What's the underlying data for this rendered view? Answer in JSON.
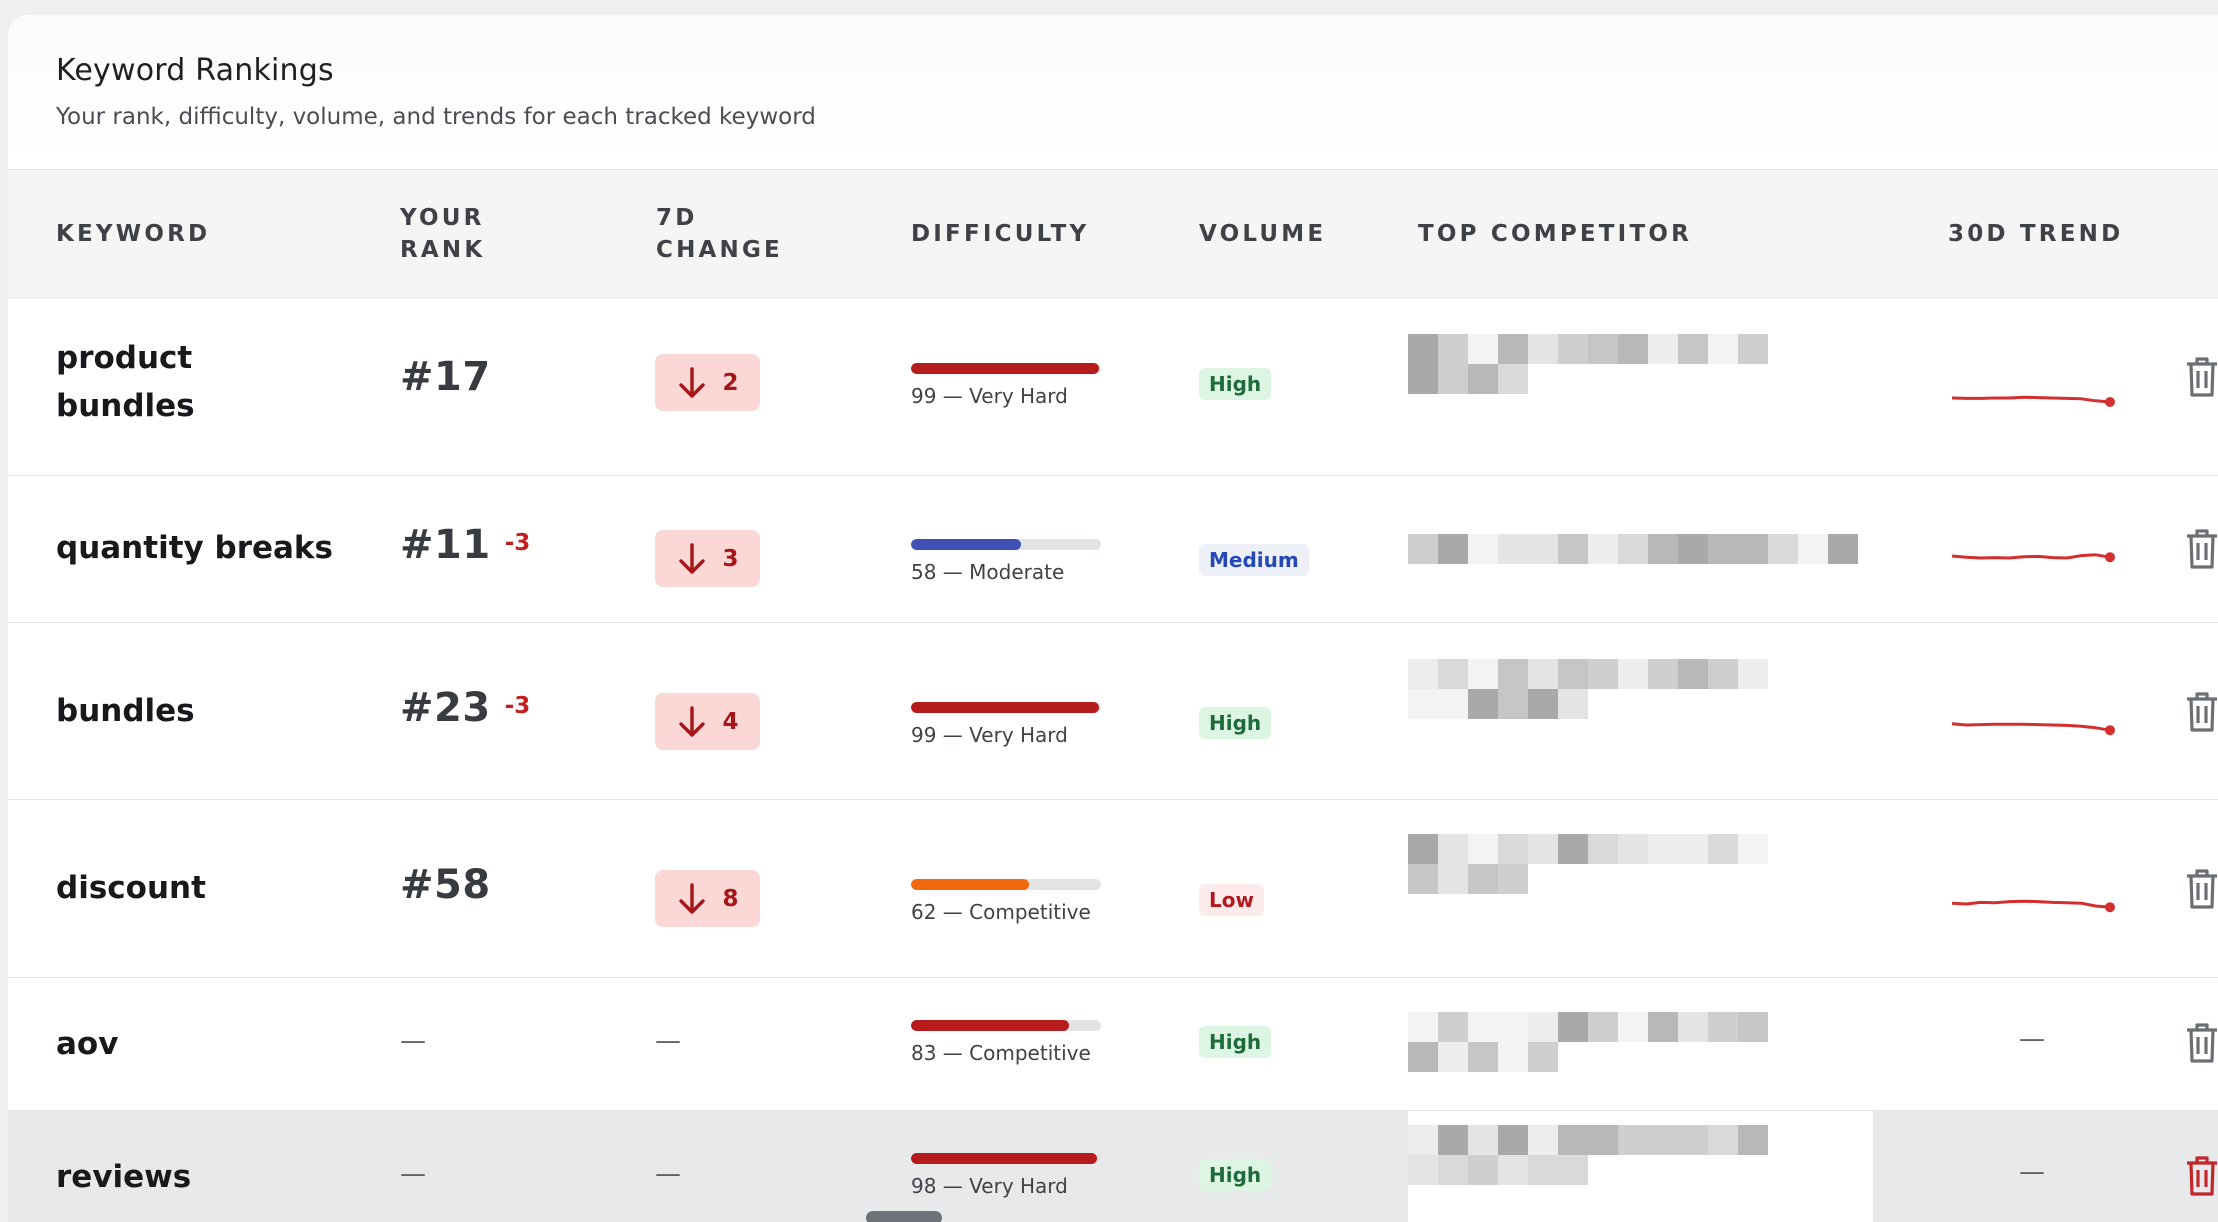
{
  "card": {
    "title": "Keyword Rankings",
    "subtitle": "Your rank, difficulty, volume, and trends for each tracked keyword"
  },
  "columns": {
    "keyword": "KEYWORD",
    "rank_1": "YOUR",
    "rank_2": "RANK",
    "change_1": "7D",
    "change_2": "CHANGE",
    "difficulty": "DIFFICULTY",
    "volume": "VOLUME",
    "competitor": "TOP COMPETITOR",
    "trend": "30D TREND"
  },
  "colors": {
    "very_hard": "#b71c1c",
    "moderate": "#3f51b5",
    "competitive": "#f26a10",
    "trend_line": "#d32f2f"
  },
  "rows": [
    {
      "keyword_1": "product",
      "keyword_2": "bundles",
      "rank": "#17",
      "rank_delta": "",
      "change": "2",
      "change_direction": "down",
      "difficulty_value": 99,
      "difficulty_label": "99 — Very Hard",
      "volume": "High",
      "volume_level": "high",
      "competitor": "redacted",
      "trend": [
        0.45,
        0.46,
        0.46,
        0.45,
        0.45,
        0.43,
        0.44,
        0.45,
        0.46,
        0.47,
        0.52,
        0.55
      ],
      "delete_icon": "trash-icon"
    },
    {
      "keyword_1": "quantity breaks",
      "rank": "#11",
      "rank_delta": "-3",
      "change": "3",
      "change_direction": "down",
      "difficulty_value": 58,
      "difficulty_label": "58 — Moderate",
      "volume": "Medium",
      "volume_level": "medium",
      "competitor": "redacted",
      "trend": [
        0.45,
        0.48,
        0.5,
        0.49,
        0.5,
        0.47,
        0.46,
        0.49,
        0.5,
        0.44,
        0.42,
        0.48
      ],
      "delete_icon": "trash-icon"
    },
    {
      "keyword_1": "bundles",
      "rank": "#23",
      "rank_delta": "-3",
      "change": "4",
      "change_direction": "down",
      "difficulty_value": 99,
      "difficulty_label": "99 — Very Hard",
      "volume": "High",
      "volume_level": "high",
      "competitor": "redacted",
      "trend": [
        0.42,
        0.45,
        0.44,
        0.43,
        0.43,
        0.43,
        0.44,
        0.45,
        0.46,
        0.48,
        0.52,
        0.58
      ],
      "delete_icon": "trash-icon"
    },
    {
      "keyword_1": "discount",
      "rank": "#58",
      "rank_delta": "",
      "change": "8",
      "change_direction": "down",
      "difficulty_value": 62,
      "difficulty_label": "62 — Competitive",
      "volume": "Low",
      "volume_level": "low",
      "competitor": "redacted",
      "trend": [
        0.48,
        0.5,
        0.46,
        0.47,
        0.44,
        0.43,
        0.44,
        0.46,
        0.47,
        0.48,
        0.55,
        0.58
      ],
      "delete_icon": "trash-icon"
    },
    {
      "keyword_1": "aov",
      "rank": "—",
      "change": "—",
      "difficulty_value": 83,
      "difficulty_label": "83 — Competitive",
      "volume": "High",
      "volume_level": "high",
      "competitor": "redacted",
      "trend_text": "—",
      "delete_icon": "trash-icon"
    },
    {
      "keyword_1": "reviews",
      "rank": "—",
      "change": "—",
      "difficulty_value": 98,
      "difficulty_label": "98 — Very Hard",
      "volume": "High",
      "volume_level": "high",
      "competitor": "redacted",
      "trend_text": "—",
      "delete_icon": "trash-icon"
    }
  ]
}
